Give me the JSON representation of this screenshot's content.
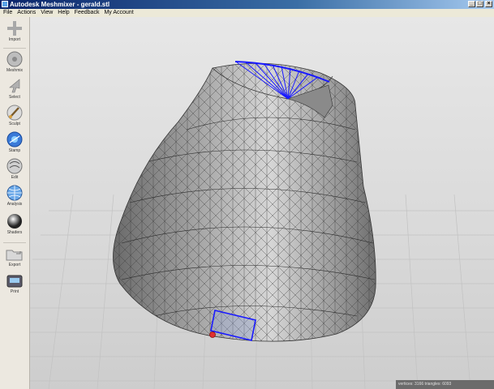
{
  "window": {
    "title": "Autodesk Meshmixer - gerald.stl",
    "minimize": "_",
    "maximize": "□",
    "close": "×"
  },
  "menu": {
    "items": [
      "File",
      "Actions",
      "View",
      "Help",
      "Feedback",
      "My Account"
    ]
  },
  "toolbar": {
    "tools": [
      {
        "label": "Import",
        "icon": "plus-icon"
      },
      {
        "label": "Meshmix",
        "icon": "meshmix-icon"
      },
      {
        "label": "Select",
        "icon": "select-arrow-icon"
      },
      {
        "label": "Sculpt",
        "icon": "brush-icon"
      },
      {
        "label": "Stamp",
        "icon": "stamp-icon"
      },
      {
        "label": "Edit",
        "icon": "edit-icon"
      },
      {
        "label": "Analysis",
        "icon": "analysis-icon"
      },
      {
        "label": "Shaders",
        "icon": "shader-sphere-icon"
      },
      {
        "label": "Export",
        "icon": "folder-icon"
      },
      {
        "label": "Print",
        "icon": "printer-icon"
      }
    ]
  },
  "status": {
    "text": "vertices: 3166 triangles: 6093"
  },
  "colors": {
    "selection": "#1a1aff",
    "mesh": "#9a9a9a",
    "pivot": "#e03030"
  }
}
